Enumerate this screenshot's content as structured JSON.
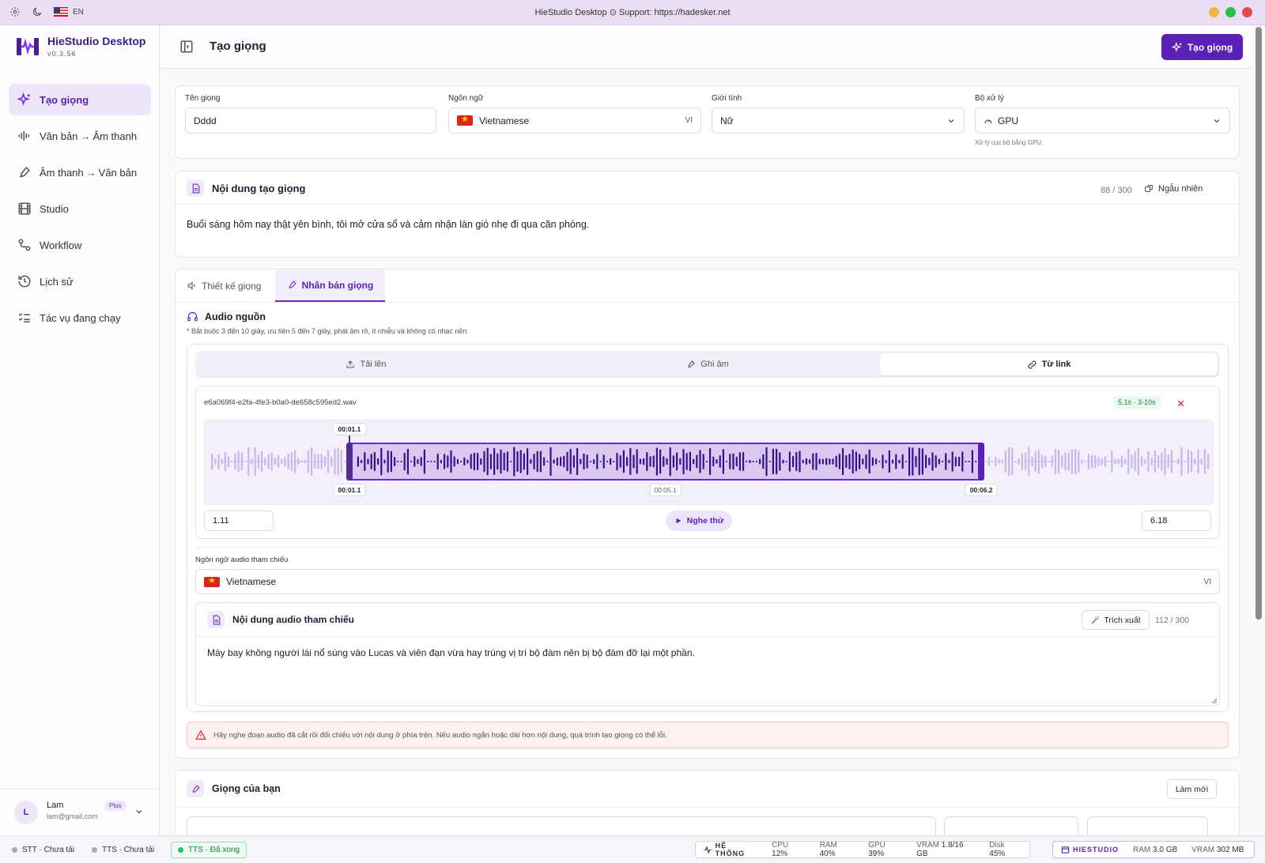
{
  "titlebar": {
    "lang": "EN",
    "title": "HieStudio Desktop ⊙ Support: https://hadesker.net",
    "window_dots": [
      "#f5b544",
      "#2fba4d",
      "#e5484d"
    ]
  },
  "brand": {
    "name": "HieStudio Desktop",
    "version": "v0.3.56"
  },
  "nav": {
    "items": [
      {
        "label": "Tạo giọng",
        "icon": "sparkles-icon",
        "active": true
      },
      {
        "label_a": "Văn bản",
        "label_b": "Âm thanh",
        "icon": "waveform-icon"
      },
      {
        "label_a": "Âm thanh",
        "label_b": "Văn bản",
        "icon": "mic-pen-icon"
      },
      {
        "label": "Studio",
        "icon": "film-icon"
      },
      {
        "label": "Workflow",
        "icon": "workflow-icon"
      },
      {
        "label": "Lịch sử",
        "icon": "history-icon"
      },
      {
        "label": "Tác vụ đang chạy",
        "icon": "tasks-icon"
      }
    ]
  },
  "user": {
    "initial": "L",
    "name": "Lam",
    "email": "lam@gmail.com",
    "plan": "Plus"
  },
  "header": {
    "title": "Tạo giọng",
    "create_label": "Tạo giọng"
  },
  "form": {
    "name_label": "Tên giọng",
    "name_value": "Dddd",
    "lang_label": "Ngôn ngữ",
    "lang_value": "Vietnamese",
    "lang_code": "VI",
    "gender_label": "Giới tính",
    "gender_value": "Nữ",
    "proc_label": "Bộ xử lý",
    "proc_value": "GPU",
    "proc_hint": "Xử lý cục bộ bằng GPU."
  },
  "content": {
    "title": "Nội dung tạo giọng",
    "count": "88 / 300",
    "random_label": "Ngẫu nhiên",
    "text": "Buổi sáng hôm nay thật yên bình, tôi mở cửa sổ và cảm nhận làn gió nhẹ đi qua căn phòng."
  },
  "tabs": [
    {
      "label": "Thiết kế giọng",
      "active": false
    },
    {
      "label": "Nhân bản giọng",
      "active": true
    }
  ],
  "audio": {
    "title": "Audio nguồn",
    "hint": "* Bắt buộc 3 đến 10 giây, ưu tiên 5 đến 7 giây, phát âm rõ, ít nhiễu và không có nhạc nền",
    "source_tabs": [
      {
        "label": "Tải lên",
        "active": false
      },
      {
        "label": "Ghi âm",
        "active": false
      },
      {
        "label": "Từ link",
        "active": true
      }
    ],
    "filename": "e6a069f4-e2fa-4fe3-b0a0-de658c595ed2.wav",
    "duration_badge": "5.1s · 3-10s",
    "marker_top": "00:01.1",
    "label_start": "00:01.1",
    "label_mid": "00:05.1",
    "label_end": "00:06.2",
    "duration_s": 8.0,
    "trim_start_s": 1.11,
    "trim_end_s": 6.18,
    "start_value": "1.11",
    "end_value": "6.18",
    "play_label": "Nghe thử"
  },
  "reference": {
    "lang_label": "Ngôn ngữ audio tham chiếu",
    "lang_value": "Vietnamese",
    "lang_code": "VI",
    "title": "Nội dung audio tham chiếu",
    "extract_label": "Trích xuất",
    "count": "112 / 300",
    "text": "Máy bay không người lái nổ súng vào Lucas và viên đạn vừa hay trúng vị trí bộ đàm nên bị bộ đàm đỡ lại một phần."
  },
  "warning": "Hãy nghe đoạn audio đã cắt rồi đối chiếu với nội dung ở phía trên. Nếu audio ngắn hoặc dài hơn nội dung, quá trình tạo giọng có thể lỗi.",
  "your_voices": {
    "title": "Giọng của bạn",
    "refresh_label": "Làm mới"
  },
  "status": {
    "stt": "STT · Chưa tải",
    "tts1": "TTS · Chưa tải",
    "tts2": "TTS · Đã xong",
    "system_label": "HỆ THỐNG",
    "cpu_label": "CPU",
    "cpu": "12%",
    "ram_label": "RAM",
    "ram": "40%",
    "gpu_label": "GPU",
    "gpu": "39%",
    "vram_label": "VRAM",
    "vram": "1.8/16 GB",
    "disk_label": "Disk",
    "disk": "45%",
    "app_label": "HIESTUDIO",
    "app_ram_label": "RAM",
    "app_ram": "3.0 GB",
    "app_vram_label": "VRAM",
    "app_vram": "302 MB"
  }
}
